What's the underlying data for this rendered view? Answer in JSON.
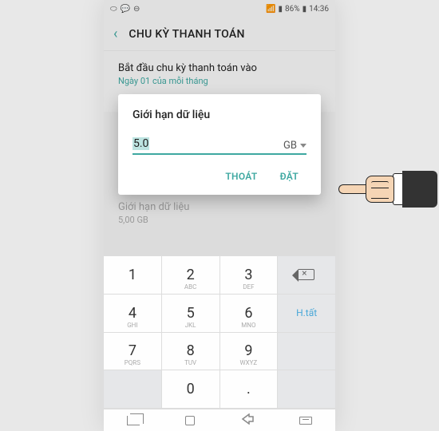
{
  "status": {
    "battery": "86%",
    "time": "14:36"
  },
  "header": {
    "title": "CHU KỲ THANH TOÁN"
  },
  "settings": {
    "billing_cycle": {
      "title": "Bắt đầu chu kỳ thanh toán vào",
      "sub": "Ngày 01 của mỗi tháng"
    },
    "data_limit": {
      "title": "Giới hạn dữ liệu",
      "sub": "5,00 GB"
    }
  },
  "dialog": {
    "title": "Giới hạn dữ liệu",
    "value": "5.0",
    "unit": "GB",
    "cancel": "THOÁT",
    "confirm": "ĐẶT"
  },
  "keypad": {
    "k1": "1",
    "k2": "2",
    "k3": "3",
    "k4": "4",
    "k5": "5",
    "k6": "6",
    "k7": "7",
    "k8": "8",
    "k9": "9",
    "k0": "0",
    "dot": ".",
    "done": "H.tất",
    "s2": "ABC",
    "s3": "DEF",
    "s4": "GHI",
    "s5": "JKL",
    "s6": "MNO",
    "s7": "PQRS",
    "s8": "TUV",
    "s9": "WXYZ"
  }
}
